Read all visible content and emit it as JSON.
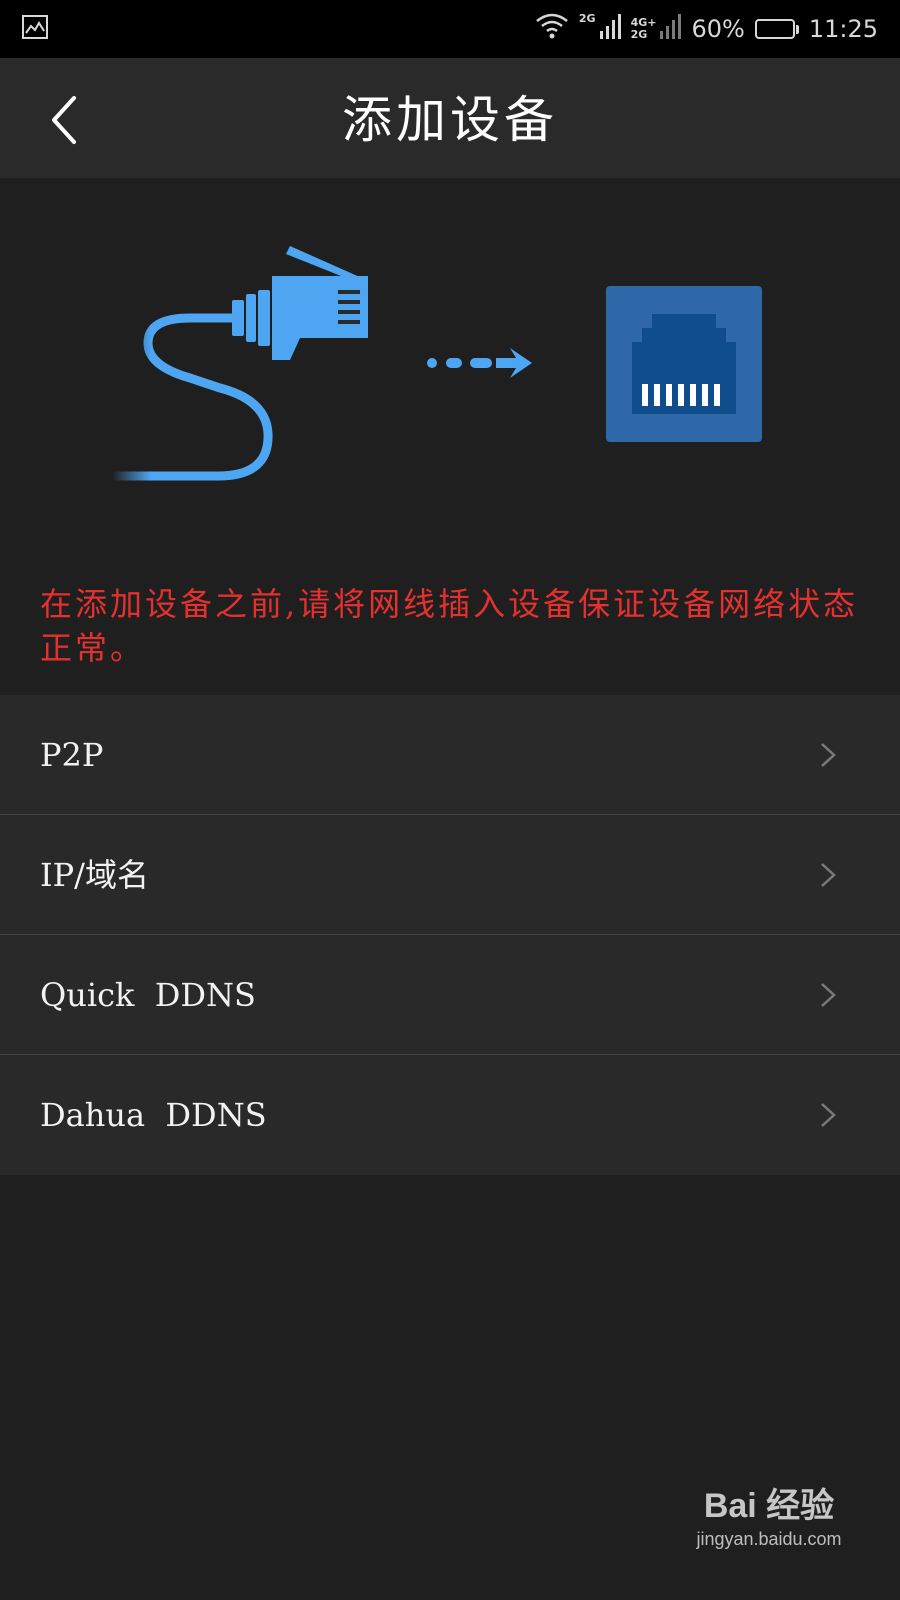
{
  "status_bar": {
    "network_top": "2G",
    "network_mid_top": "4G+",
    "network_mid_bottom": "2G",
    "battery_percent": "60%",
    "battery_level": 0.6,
    "time": "11:25",
    "left_icon": "gallery-icon"
  },
  "header": {
    "title": "添加设备",
    "back_icon": "chevron-left-icon"
  },
  "illustration": {
    "cable_icon": "ethernet-cable-icon",
    "arrow_icon": "dotted-arrow-icon",
    "port_icon": "ethernet-port-icon",
    "colors": {
      "cable": "#4ea6f2",
      "port_bg": "#2f68a8",
      "port_inner": "#0f4d8c"
    }
  },
  "notice": {
    "text": "在添加设备之前,请将网线插入设备保证设备网络状态正常。",
    "color": "#e3312f"
  },
  "menu": {
    "items": [
      {
        "label": "P2P"
      },
      {
        "label": "IP/域名"
      },
      {
        "label": "Quick  DDNS"
      },
      {
        "label": "Dahua  DDNS"
      }
    ]
  },
  "watermark": {
    "brand": "Bai 经验",
    "url": "jingyan.baidu.com"
  }
}
